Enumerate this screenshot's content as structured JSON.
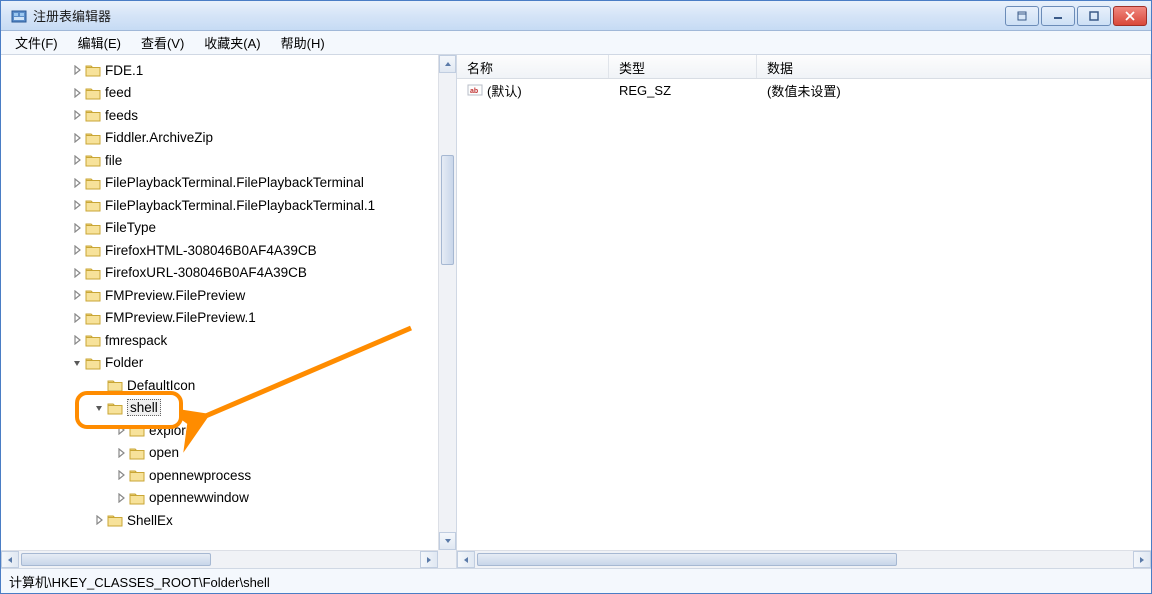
{
  "window": {
    "title": "注册表编辑器"
  },
  "menu": {
    "file": "文件(F)",
    "edit": "编辑(E)",
    "view": "查看(V)",
    "favorites": "收藏夹(A)",
    "help": "帮助(H)"
  },
  "tree": {
    "items": [
      {
        "label": "FDE.1",
        "depth": 3,
        "expander": "closed"
      },
      {
        "label": "feed",
        "depth": 3,
        "expander": "closed"
      },
      {
        "label": "feeds",
        "depth": 3,
        "expander": "closed"
      },
      {
        "label": "Fiddler.ArchiveZip",
        "depth": 3,
        "expander": "closed"
      },
      {
        "label": "file",
        "depth": 3,
        "expander": "closed"
      },
      {
        "label": "FilePlaybackTerminal.FilePlaybackTerminal",
        "depth": 3,
        "expander": "closed"
      },
      {
        "label": "FilePlaybackTerminal.FilePlaybackTerminal.1",
        "depth": 3,
        "expander": "closed"
      },
      {
        "label": "FileType",
        "depth": 3,
        "expander": "closed"
      },
      {
        "label": "FirefoxHTML-308046B0AF4A39CB",
        "depth": 3,
        "expander": "closed"
      },
      {
        "label": "FirefoxURL-308046B0AF4A39CB",
        "depth": 3,
        "expander": "closed"
      },
      {
        "label": "FMPreview.FilePreview",
        "depth": 3,
        "expander": "closed"
      },
      {
        "label": "FMPreview.FilePreview.1",
        "depth": 3,
        "expander": "closed"
      },
      {
        "label": "fmrespack",
        "depth": 3,
        "expander": "closed"
      },
      {
        "label": "Folder",
        "depth": 3,
        "expander": "open"
      },
      {
        "label": "DefaultIcon",
        "depth": 4,
        "expander": "none"
      },
      {
        "label": "shell",
        "depth": 4,
        "expander": "open",
        "selected": true
      },
      {
        "label": "explore",
        "depth": 5,
        "expander": "closed"
      },
      {
        "label": "open",
        "depth": 5,
        "expander": "closed"
      },
      {
        "label": "opennewprocess",
        "depth": 5,
        "expander": "closed"
      },
      {
        "label": "opennewwindow",
        "depth": 5,
        "expander": "closed"
      },
      {
        "label": "ShellEx",
        "depth": 4,
        "expander": "closed"
      }
    ]
  },
  "list": {
    "columns": {
      "name": "名称",
      "type": "类型",
      "data": "数据"
    },
    "rows": [
      {
        "name": "(默认)",
        "type": "REG_SZ",
        "data": "(数值未设置)"
      }
    ]
  },
  "statusbar": {
    "path": "计算机\\HKEY_CLASSES_ROOT\\Folder\\shell"
  }
}
